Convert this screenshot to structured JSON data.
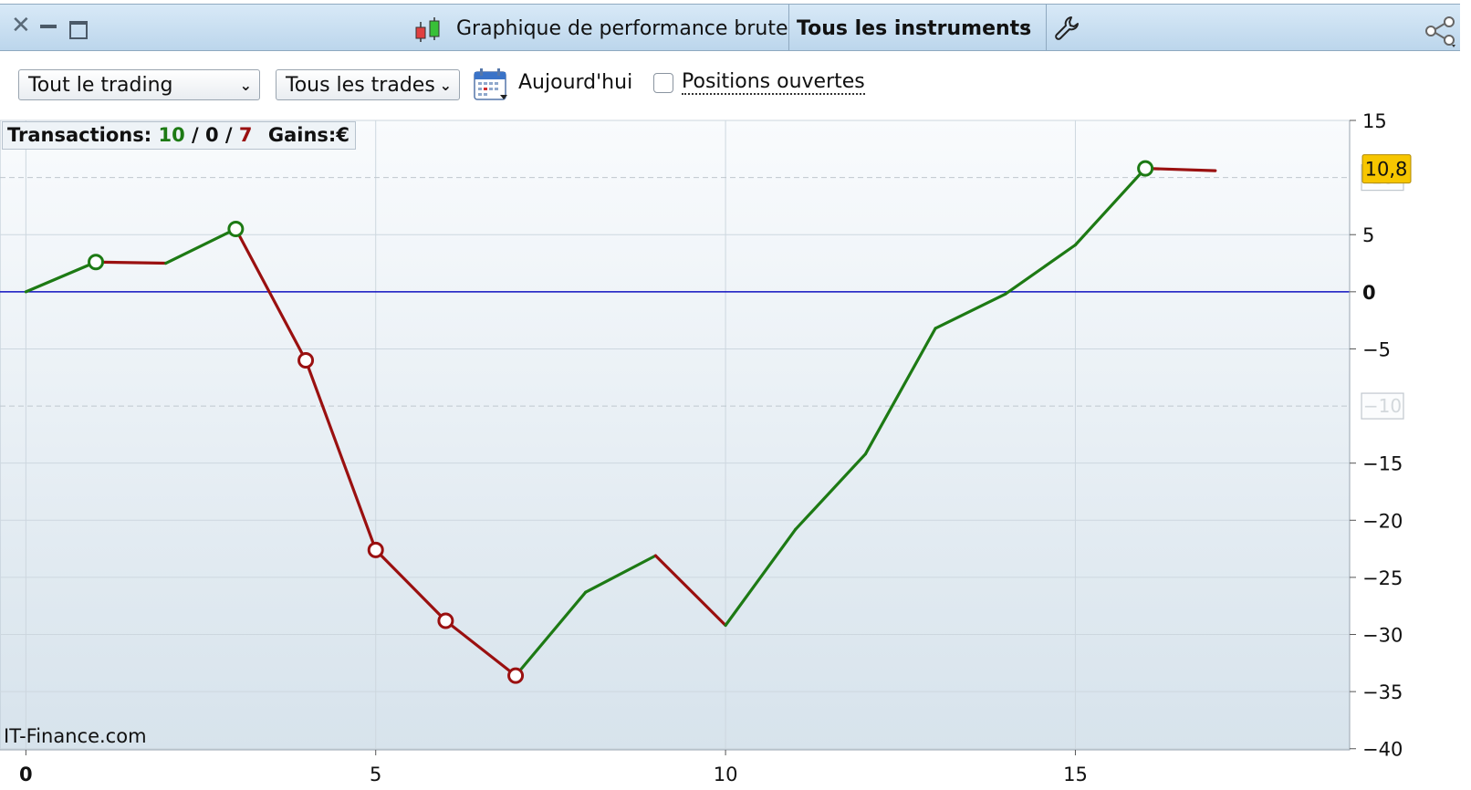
{
  "window": {
    "title": "Graphique de performance brute",
    "instrument_selector": "Tous les instruments"
  },
  "toolbar": {
    "trading_filter": "Tout le trading",
    "trades_filter": "Tous les trades",
    "date_label": "Aujourd'hui",
    "open_positions_label": "Positions ouvertes",
    "open_positions_checked": false
  },
  "stats": {
    "transactions_label": "Transactions:",
    "wins": "10",
    "even": "0",
    "losses": "7",
    "separator": "/",
    "gains_label": "Gains:",
    "currency": "€"
  },
  "watermark": "IT-Finance.com",
  "colors": {
    "up": "#1d7a14",
    "down": "#9a1010",
    "zero_line": "#1010c0",
    "last_value_bg": "#f7c600"
  },
  "chart_data": {
    "type": "line",
    "x": [
      0,
      1,
      2,
      3,
      4,
      5,
      6,
      7,
      8,
      9,
      10,
      11,
      12,
      13,
      14,
      15,
      16,
      17
    ],
    "y": [
      0,
      2.6,
      2.5,
      5.5,
      -6,
      -22.6,
      -28.8,
      -33.6,
      -26.3,
      -23.1,
      -29.2,
      -20.8,
      -14.2,
      -3.2,
      -0.2,
      4.1,
      10.8,
      10.6
    ],
    "markers": [
      {
        "x": 1,
        "y": 2.6,
        "color": "up"
      },
      {
        "x": 3,
        "y": 5.5,
        "color": "up"
      },
      {
        "x": 4,
        "y": -6,
        "color": "down"
      },
      {
        "x": 5,
        "y": -22.6,
        "color": "down"
      },
      {
        "x": 6,
        "y": -28.8,
        "color": "down"
      },
      {
        "x": 7,
        "y": -33.6,
        "color": "down"
      },
      {
        "x": 16,
        "y": 10.8,
        "color": "up"
      }
    ],
    "xlim": [
      -0.37,
      18.92
    ],
    "ylim": [
      -40.1,
      15
    ],
    "xticks": [
      "0",
      "5",
      "10",
      "15"
    ],
    "xtick_values": [
      0,
      5,
      10,
      15
    ],
    "yticks": [
      "15",
      "5",
      "0",
      "−5",
      "−15",
      "−20",
      "−25",
      "−30",
      "−35",
      "−40"
    ],
    "ytick_values": [
      15,
      5,
      0,
      -5,
      -15,
      -20,
      -25,
      -30,
      -35,
      -40
    ],
    "dashed_levels": [
      10,
      -10
    ],
    "dashed_labels": [
      "10",
      "−10"
    ],
    "last_value_label": "10,8",
    "grid": true
  }
}
